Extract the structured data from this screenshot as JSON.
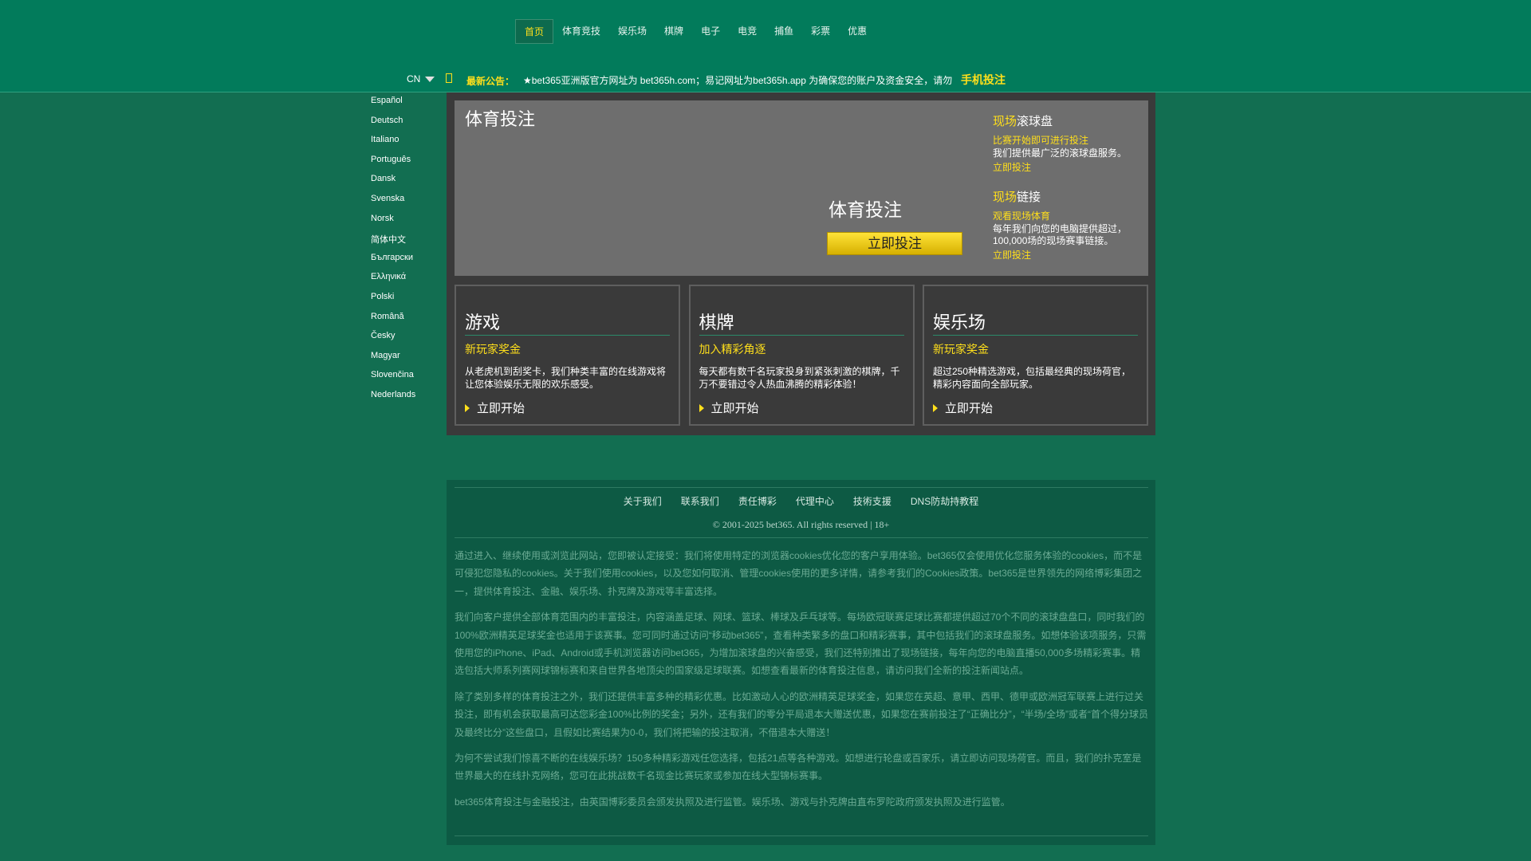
{
  "header": {
    "nav": [
      "首页",
      "体育竞技",
      "娱乐场",
      "棋牌",
      "电子",
      "电竞",
      "捕鱼",
      "彩票",
      "优惠"
    ],
    "lang_current": "CN",
    "notice_label": "最新公告：",
    "notice_text": "★bet365亚洲版官方网址为 bet365h.com；易记网址为bet365h.app 为确保您的账户及资金安全，请勿",
    "mobile_link": "手机投注"
  },
  "languages": [
    "Español",
    "Deutsch",
    "Italiano",
    "Português",
    "Dansk",
    "Svenska",
    "Norsk",
    "简体中文",
    "Български",
    "Ελληνικά",
    "Polski",
    "Română",
    "Česky",
    "Magyar",
    "Slovenčina",
    "Nederlands"
  ],
  "hero": {
    "title": "体育投注",
    "center_title": "体育投注",
    "button": "立即投注",
    "live": [
      {
        "hl": "现场",
        "title": "滚球盘",
        "sub": "比赛开始即可进行投注",
        "desc": "我们提供最广泛的滚球盘服务。",
        "link": "立即投注"
      },
      {
        "hl": "现场",
        "title": "链接",
        "sub": "观看现场体育",
        "desc": "每年我们向您的电脑提供超过，100,000场的现场赛事链接。",
        "link": "立即投注"
      }
    ]
  },
  "cards": [
    {
      "title": "游戏",
      "sub": "新玩家奖金",
      "desc": "从老虎机到刮奖卡，我们种类丰富的在线游戏将让您体验娱乐无限的欢乐感受。",
      "cta": "立即开始"
    },
    {
      "title": "棋牌",
      "sub": "加入精彩角逐",
      "desc": "每天都有数千名玩家投身到紧张刺激的棋牌，千万不要错过令人热血沸腾的精彩体验！",
      "cta": "立即开始"
    },
    {
      "title": "娱乐场",
      "sub": "新玩家奖金",
      "desc": "超过250种精选游戏，包括最经典的现场荷官，精彩内容面向全部玩家。",
      "cta": "立即开始"
    }
  ],
  "footer": {
    "links": [
      "关于我们",
      "联系我们",
      "责任博彩",
      "代理中心",
      "技術支援",
      "DNS防劫持教程"
    ],
    "copyright": "© 2001-2025 bet365. All rights reserved | 18+",
    "paragraphs": [
      "通过进入、继续使用或浏览此网站，您即被认定接受：我们将使用特定的浏览器cookies优化您的客户享用体验。bet365仅会使用优化您服务体验的cookies，而不是可侵犯您隐私的cookies。关于我们使用cookies，以及您如何取消、管理cookies使用的更多详情，请参考我们的Cookies政策。bet365是世界领先的网络博彩集团之一，提供体育投注、金融、娱乐场、扑克牌及游戏等丰富选择。",
      "我们向客户提供全部体育范围内的丰富投注，内容涵盖足球、网球、篮球、棒球及乒乓球等。每场欧冠联赛足球比赛都提供超过70个不同的滚球盘盘口，同时我们的100%欧洲精英足球奖金也适用于该赛事。您可同时通过访问“移动bet365”，查看种类繁多的盘口和精彩赛事，其中包括我们的滚球盘服务。如想体验该项服务，只需使用您的iPhone、iPad、Android或手机浏览器访问bet365，为增加滚球盘的兴奋感受，我们还特别推出了现场链接，每年向您的电脑直播50,000多场精彩赛事。精选包括大师系列赛网球锦标赛和来自世界各地顶尖的国家级足球联赛。如想查看最新的体育投注信息，请访问我们全新的投注新闻站点。",
      "除了类别多样的体育投注之外，我们还提供丰富多种的精彩优惠。比如激动人心的欧洲精英足球奖金，如果您在英超、意甲、西甲、德甲或欧洲冠军联赛上进行过关投注，即有机会获取最高可达您彩金100%比例的奖金；另外，还有我们的零分平局退本大赠送优惠，如果您在赛前投注了“正确比分”，“半场/全场”或者“首个得分球员及最终比分”这些盘口，且假如比赛结果为0-0，我们将把输的投注取消，不借退本大赠送！",
      "为何不尝试我们惊喜不断的在线娱乐场？150多种精彩游戏任您选择，包括21点等各种游戏。如想进行轮盘或百家乐，请立即访问现场荷官。而且，我们的扑克室是世界最大的在线扑克网络，您可在此挑战数千名现金比赛玩家或参加在线大型锦标赛事。",
      "bet365体育投注与金融投注，由英国博彩委员会颁发执照及进行监管。娱乐场、游戏与扑克牌由直布罗陀政府颁发执照及进行监管。"
    ]
  },
  "colors": {
    "accent": "#ffdf1b",
    "header_bg": "#027b5b",
    "page_bg": "#126e51",
    "panel_bg": "#3a3a3a",
    "footer_bg": "#0d5a44"
  }
}
